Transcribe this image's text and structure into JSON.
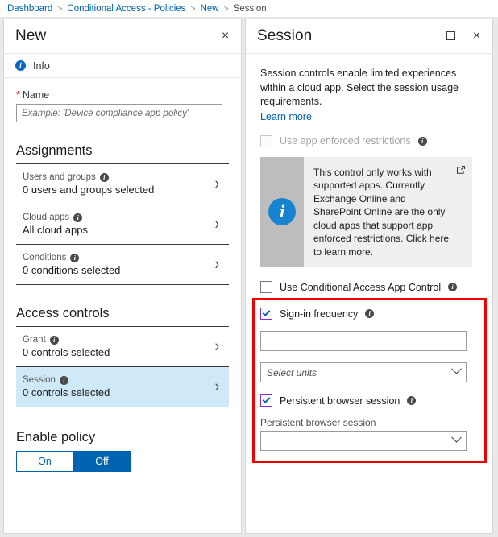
{
  "breadcrumb": {
    "items": [
      {
        "label": "Dashboard",
        "type": "link"
      },
      {
        "label": "Conditional Access - Policies",
        "type": "link"
      },
      {
        "label": "New",
        "type": "link"
      },
      {
        "label": "Session",
        "type": "current"
      }
    ],
    "separator": ">"
  },
  "new_blade": {
    "title": "New",
    "close_label": "×",
    "info_label": "Info",
    "name_field": {
      "label": "Name",
      "required_marker": "*",
      "value": "",
      "placeholder": "Example: 'Device compliance app policy'"
    },
    "assignments": {
      "title": "Assignments",
      "rows": [
        {
          "label": "Users and groups",
          "sub": "0 users and groups selected",
          "chevron": "›",
          "selected": false
        },
        {
          "label": "Cloud apps",
          "sub": "All cloud apps",
          "chevron": "›",
          "selected": false
        },
        {
          "label": "Conditions",
          "sub": "0 conditions selected",
          "chevron": "›",
          "selected": false
        }
      ]
    },
    "access_controls": {
      "title": "Access controls",
      "rows": [
        {
          "label": "Grant",
          "sub": "0 controls selected",
          "chevron": "›",
          "selected": false
        },
        {
          "label": "Session",
          "sub": "0 controls selected",
          "chevron": "›",
          "selected": true
        }
      ]
    },
    "enable_policy": {
      "title": "Enable policy",
      "on_label": "On",
      "off_label": "Off",
      "selected": "Off",
      "accent_color": "#0063b1"
    }
  },
  "session_blade": {
    "title": "Session",
    "maximize_label": "□",
    "close_label": "×",
    "description": "Session controls enable limited experiences within a cloud app. Select the session usage requirements.",
    "learn_more": "Learn more",
    "app_enforced": {
      "label": "Use app enforced restrictions",
      "checked": false,
      "disabled": true
    },
    "callout": {
      "text": "This control only works with supported apps. Currently Exchange Online and SharePoint Online are the only cloud apps that support app enforced restrictions. Click here to learn more.",
      "icon": "i",
      "external_link_icon": "external-link"
    },
    "app_control": {
      "label": "Use Conditional Access App Control",
      "checked": false
    },
    "sign_in_frequency": {
      "label": "Sign-in frequency",
      "checked": true,
      "value": "",
      "units_placeholder": "Select units"
    },
    "persistent_browser": {
      "label": "Persistent browser session",
      "checked": true,
      "field_label": "Persistent browser session",
      "value": ""
    },
    "highlight_color": "#ef0000",
    "checkbox_focus_color": "#8a2be2"
  }
}
